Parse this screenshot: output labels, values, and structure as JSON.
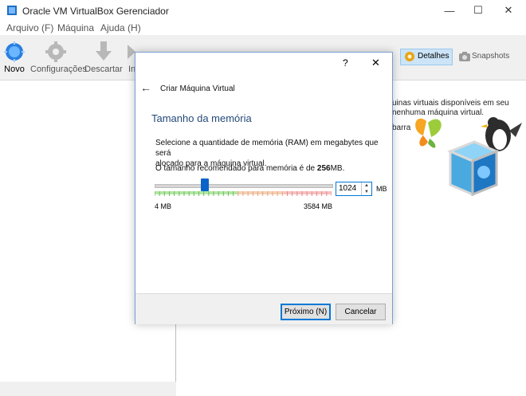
{
  "window": {
    "title": "Oracle VM VirtualBox Gerenciador",
    "controls": {
      "minimize": "—",
      "maximize": "☐",
      "close": "✕"
    }
  },
  "menu": {
    "items": [
      {
        "label": "Arquivo (F)"
      },
      {
        "label": "Máquina"
      },
      {
        "label": "Ajuda (H)"
      }
    ]
  },
  "toolbar": {
    "new_label": "Novo",
    "settings_label": "Configurações",
    "discard_label": "Descartar",
    "start_label": "In",
    "details_label": "Detalhes",
    "snapshots_label": "Snapshots"
  },
  "welcome": {
    "line1": "uinas virtuais disponíveis em seu",
    "line2": "nenhuma máquina virtual.",
    "line3": "barra"
  },
  "dialog": {
    "help": "?",
    "close": "✕",
    "back_arrow": "←",
    "header": "Criar Máquina Virtual",
    "section_title": "Tamanho da memória",
    "description_line1": "Selecione a quantidade de memória (RAM) em megabytes que será",
    "description_line2": "alocado para a máquina virtual.",
    "recommended_prefix": "O tamanho recomendado para memória é de ",
    "recommended_value": "256",
    "recommended_suffix": "MB.",
    "memory_value": "1024",
    "memory_unit": "MB",
    "slider_min_label": "4 MB",
    "slider_max_label": "3584 MB",
    "slider": {
      "min": 4,
      "max": 3584,
      "value": 1024
    },
    "next_button": "Próximo (N)",
    "cancel_button": "Cancelar"
  }
}
